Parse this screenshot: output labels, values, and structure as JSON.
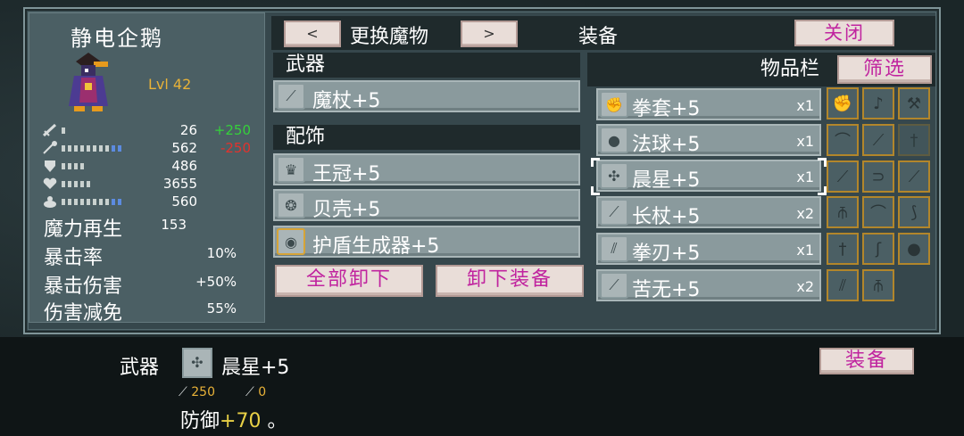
{
  "character": {
    "name": "静电企鹅",
    "level": "Lvl 42",
    "stats": [
      {
        "icon": "sword-icon",
        "value": "26",
        "mod": "+250",
        "mod_color": "#35d13b",
        "bars": 1,
        "extra_bars": 0
      },
      {
        "icon": "wand-icon",
        "value": "562",
        "mod": "-250",
        "mod_color": "#e2322d",
        "bars": 8,
        "extra_bars": 2
      },
      {
        "icon": "shield-icon",
        "value": "486",
        "mod": "",
        "mod_color": "#ffffff",
        "bars": 4,
        "extra_bars": 0
      },
      {
        "icon": "heart-icon",
        "value": "3655",
        "mod": "",
        "mod_color": "#ffffff",
        "bars": 5,
        "extra_bars": 0
      },
      {
        "icon": "mana-icon",
        "value": "560",
        "mod": "",
        "mod_color": "#ffffff",
        "bars": 8,
        "extra_bars": 2
      }
    ],
    "big_stats": [
      {
        "label": "魔力再生",
        "value": "153"
      },
      {
        "label": "暴击率",
        "value": "10%"
      },
      {
        "label": "暴击伤害",
        "value": "+50%"
      },
      {
        "label": "伤害减免",
        "value": "55%"
      }
    ]
  },
  "header": {
    "prev_label": "<",
    "next_label": ">",
    "change_monster": "更换魔物",
    "equipment_title": "装备",
    "close_label": "关闭"
  },
  "equipped": {
    "weapon_section": "武器",
    "weapon": {
      "name": "魔杖+5",
      "icon": "staff-icon"
    },
    "accessory_section": "配饰",
    "accessories": [
      {
        "name": "王冠+5",
        "icon": "crown-icon"
      },
      {
        "name": "贝壳+5",
        "icon": "shell-icon"
      },
      {
        "name": "护盾生成器+5",
        "icon": "shield-generator-icon"
      }
    ],
    "unequip_all_label": "全部卸下",
    "unequip_label": "卸下装备"
  },
  "inventory": {
    "title": "物品栏",
    "filter_label": "筛选",
    "items": [
      {
        "name": "拳套+5",
        "count": "x1",
        "icon": "gauntlet-icon"
      },
      {
        "name": "法球+5",
        "count": "x1",
        "icon": "orb-icon"
      },
      {
        "name": "晨星+5",
        "count": "x1",
        "icon": "morningstar-icon"
      },
      {
        "name": "长杖+5",
        "count": "x2",
        "icon": "longstaff-icon"
      },
      {
        "name": "拳刃+5",
        "count": "x1",
        "icon": "fist-blade-icon"
      },
      {
        "name": "苦无+5",
        "count": "x2",
        "icon": "kunai-icon"
      }
    ],
    "grid_icons": [
      "gauntlet-icon",
      "lute-icon",
      "hammer-icon",
      "boomerang-icon",
      "stick-icon",
      "sword-faded-icon",
      "torch-icon",
      "hook-icon",
      "staff-dark-icon",
      "trident-icon",
      "bow-icon",
      "scythe-icon",
      "dagger-icon",
      "claw-icon",
      "orb-dark-icon",
      "blade-icon",
      "spear-icon"
    ]
  },
  "detail": {
    "type": "武器",
    "item_name": "晨星+5",
    "stat1": "250",
    "stat2": "0",
    "effect_prefix": "防御",
    "effect_value": "+70",
    "effect_suffix": "。",
    "equip_label": "装备"
  }
}
